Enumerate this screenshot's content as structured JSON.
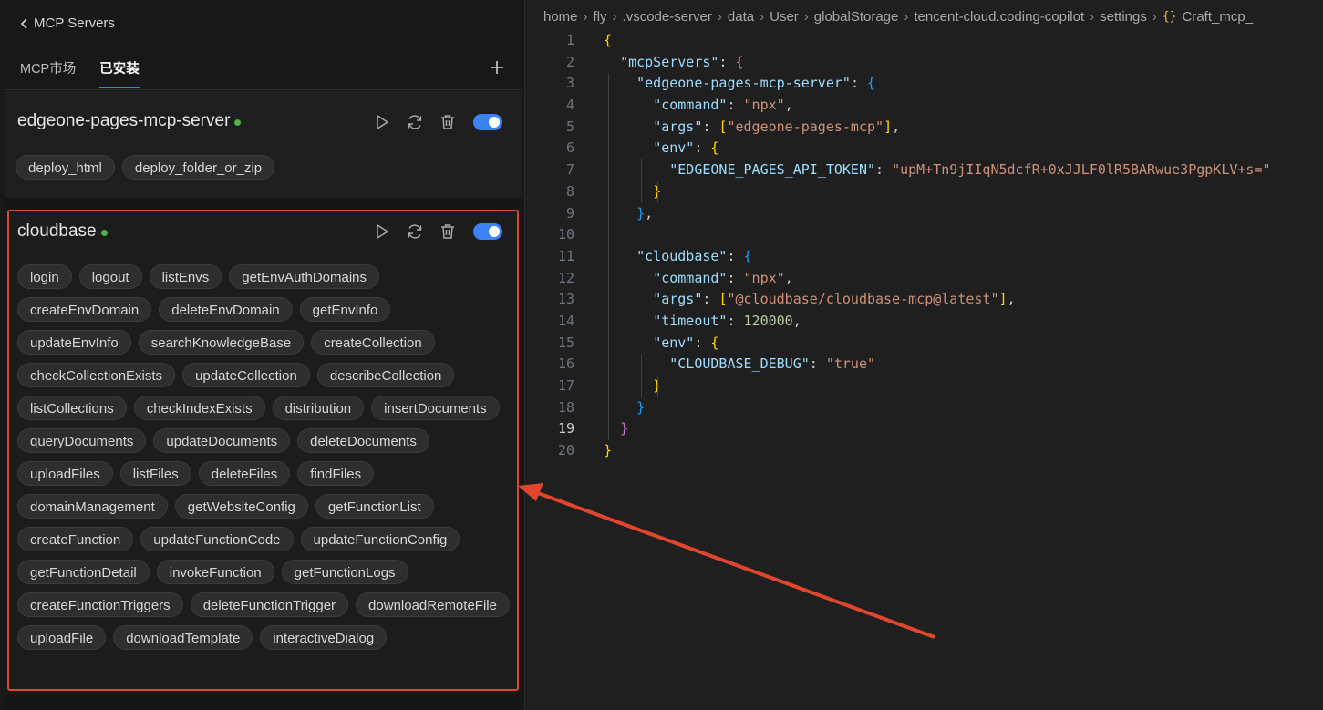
{
  "header": {
    "back_label": "MCP Servers"
  },
  "tabs": [
    {
      "label": "MCP市场",
      "active": false
    },
    {
      "label": "已安装",
      "active": true
    }
  ],
  "servers": [
    {
      "name": "edgeone-pages-mcp-server",
      "status": "running",
      "enabled": true,
      "tools": [
        "deploy_html",
        "deploy_folder_or_zip"
      ]
    },
    {
      "name": "cloudbase",
      "status": "running",
      "enabled": true,
      "tools": [
        "login",
        "logout",
        "listEnvs",
        "getEnvAuthDomains",
        "createEnvDomain",
        "deleteEnvDomain",
        "getEnvInfo",
        "updateEnvInfo",
        "searchKnowledgeBase",
        "createCollection",
        "checkCollectionExists",
        "updateCollection",
        "describeCollection",
        "listCollections",
        "checkIndexExists",
        "distribution",
        "insertDocuments",
        "queryDocuments",
        "updateDocuments",
        "deleteDocuments",
        "uploadFiles",
        "listFiles",
        "deleteFiles",
        "findFiles",
        "domainManagement",
        "getWebsiteConfig",
        "getFunctionList",
        "createFunction",
        "updateFunctionCode",
        "updateFunctionConfig",
        "getFunctionDetail",
        "invokeFunction",
        "getFunctionLogs",
        "createFunctionTriggers",
        "deleteFunctionTrigger",
        "downloadRemoteFile",
        "uploadFile",
        "downloadTemplate",
        "interactiveDialog"
      ]
    }
  ],
  "icons": {
    "back": "chevron-left-icon",
    "add": "plus-icon",
    "run": "play-icon",
    "restart": "refresh-icon",
    "delete": "trash-icon"
  },
  "colors": {
    "accent": "#3b82f6",
    "status_dot": "#4caf50",
    "highlight_border": "#e0452e"
  },
  "editor": {
    "breadcrumbs": [
      "home",
      "fly",
      ".vscode-server",
      "data",
      "User",
      "globalStorage",
      "tencent-cloud.coding-copilot",
      "settings",
      "Craft_mcp_"
    ],
    "current_line": 19,
    "lines": [
      {
        "n": "1",
        "tokens": [
          [
            "b1",
            "{"
          ]
        ]
      },
      {
        "n": "2",
        "tokens": [
          [
            "p",
            "  "
          ],
          [
            "key",
            "\"mcpServers\""
          ],
          [
            "p",
            ": "
          ],
          [
            "b2",
            "{"
          ]
        ]
      },
      {
        "n": "3",
        "tokens": [
          [
            "p",
            "    "
          ],
          [
            "key",
            "\"edgeone-pages-mcp-server\""
          ],
          [
            "p",
            ": "
          ],
          [
            "b3",
            "{"
          ]
        ]
      },
      {
        "n": "4",
        "tokens": [
          [
            "p",
            "      "
          ],
          [
            "key",
            "\"command\""
          ],
          [
            "p",
            ": "
          ],
          [
            "str",
            "\"npx\""
          ],
          [
            "p",
            ","
          ]
        ]
      },
      {
        "n": "5",
        "tokens": [
          [
            "p",
            "      "
          ],
          [
            "key",
            "\"args\""
          ],
          [
            "p",
            ": "
          ],
          [
            "b1",
            "["
          ],
          [
            "str",
            "\"edgeone-pages-mcp\""
          ],
          [
            "b1",
            "]"
          ],
          [
            "p",
            ","
          ]
        ]
      },
      {
        "n": "6",
        "tokens": [
          [
            "p",
            "      "
          ],
          [
            "key",
            "\"env\""
          ],
          [
            "p",
            ": "
          ],
          [
            "b1",
            "{"
          ]
        ]
      },
      {
        "n": "7",
        "tokens": [
          [
            "p",
            "        "
          ],
          [
            "key",
            "\"EDGEONE_PAGES_API_TOKEN\""
          ],
          [
            "p",
            ": "
          ],
          [
            "str",
            "\"upM+Tn9jIIqN5dcfR+0xJJLF0lR5BARwue3PgpKLV+s=\""
          ]
        ]
      },
      {
        "n": "8",
        "tokens": [
          [
            "p",
            "      "
          ],
          [
            "b1",
            "}"
          ]
        ]
      },
      {
        "n": "9",
        "tokens": [
          [
            "p",
            "    "
          ],
          [
            "b3",
            "}"
          ],
          [
            "p",
            ","
          ]
        ]
      },
      {
        "n": "10",
        "tokens": []
      },
      {
        "n": "11",
        "tokens": [
          [
            "p",
            "    "
          ],
          [
            "key",
            "\"cloudbase\""
          ],
          [
            "p",
            ": "
          ],
          [
            "b3",
            "{"
          ]
        ]
      },
      {
        "n": "12",
        "tokens": [
          [
            "p",
            "      "
          ],
          [
            "key",
            "\"command\""
          ],
          [
            "p",
            ": "
          ],
          [
            "str",
            "\"npx\""
          ],
          [
            "p",
            ","
          ]
        ]
      },
      {
        "n": "13",
        "tokens": [
          [
            "p",
            "      "
          ],
          [
            "key",
            "\"args\""
          ],
          [
            "p",
            ": "
          ],
          [
            "b1",
            "["
          ],
          [
            "str",
            "\"@cloudbase/cloudbase-mcp@latest\""
          ],
          [
            "b1",
            "]"
          ],
          [
            "p",
            ","
          ]
        ]
      },
      {
        "n": "14",
        "tokens": [
          [
            "p",
            "      "
          ],
          [
            "key",
            "\"timeout\""
          ],
          [
            "p",
            ": "
          ],
          [
            "num",
            "120000"
          ],
          [
            "p",
            ","
          ]
        ]
      },
      {
        "n": "15",
        "tokens": [
          [
            "p",
            "      "
          ],
          [
            "key",
            "\"env\""
          ],
          [
            "p",
            ": "
          ],
          [
            "b1",
            "{"
          ]
        ]
      },
      {
        "n": "16",
        "tokens": [
          [
            "p",
            "        "
          ],
          [
            "key",
            "\"CLOUDBASE_DEBUG\""
          ],
          [
            "p",
            ": "
          ],
          [
            "str",
            "\"true\""
          ]
        ]
      },
      {
        "n": "17",
        "tokens": [
          [
            "p",
            "      "
          ],
          [
            "b1",
            "}"
          ]
        ]
      },
      {
        "n": "18",
        "tokens": [
          [
            "p",
            "    "
          ],
          [
            "b3",
            "}"
          ]
        ]
      },
      {
        "n": "19",
        "tokens": [
          [
            "p",
            "  "
          ],
          [
            "b2",
            "}"
          ]
        ]
      },
      {
        "n": "20",
        "tokens": [
          [
            "b1",
            "}"
          ]
        ]
      }
    ]
  }
}
